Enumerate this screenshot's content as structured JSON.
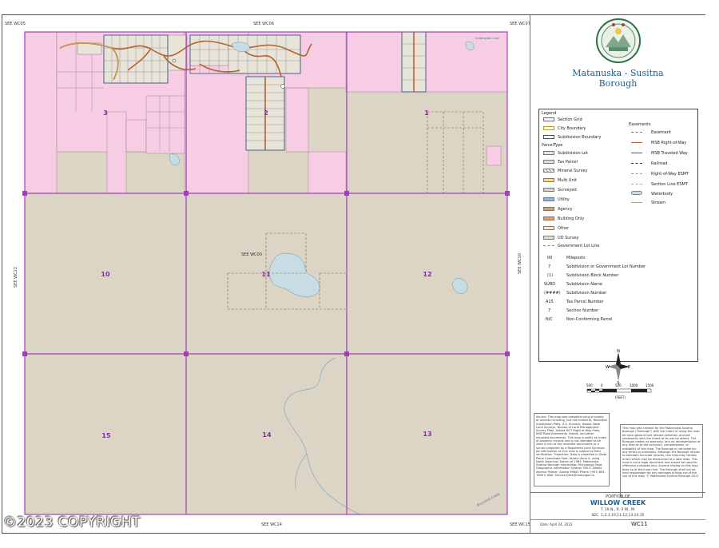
{
  "borough": {
    "name_line1": "Matanuska - Susitna",
    "name_line2": "Borough"
  },
  "see_refs": {
    "top_left": "SEE WC05",
    "top_mid": "SEE WC06",
    "top_right": "SEE WC07",
    "left": "SEE WC12",
    "right": "SEE WC10",
    "bottom_mid": "SEE WC14",
    "bottom_right": "SEE WC15",
    "center": "SEE WC00"
  },
  "sections": {
    "s3": "3",
    "s2": "2",
    "s1": "1",
    "s10": "10",
    "s11": "11",
    "s12": "12",
    "s15": "15",
    "s14": "14",
    "s13": "13"
  },
  "map_labels": {
    "stream": "Bruceline Creek",
    "lake": "Underwater Lake"
  },
  "legend": {
    "title": "Legend",
    "section_grid": "Section Grid",
    "city_boundary": "City Boundary",
    "subdivision_boundary": "Subdivision Boundary",
    "parcel_type": "ParcelType",
    "subdivision_lot": "Subdivision Lot",
    "tax_parcel": "Tax Parcel",
    "mineral_survey": "Mineral Survey",
    "multi_unit": "Multi Unit",
    "surveyed": "Surveyed",
    "utility": "Utility",
    "agency": "Agency",
    "building_only": "Building Only",
    "other": "Other",
    "ud_survey": "UD Survey",
    "gov_lot_line": "Government Lot Line",
    "easements": "Easements",
    "easement": "Easement",
    "msb_row": "MSB Right-of-Way",
    "msb_traveled": "MSB Traveled Way",
    "railroad": "Railroad",
    "row_esmt": "Right-of-Way ESMT",
    "section_line_esmt": "Section Line ESMT",
    "waterbody": "Waterbody",
    "stream": "Stream",
    "mileposts_sym": "00",
    "mileposts": "Mileposts",
    "lot_num_sym": "7",
    "lot_num": "Subdivision or Government Lot Number",
    "block_sym": "(1)",
    "block": "Subdivision Block Number",
    "subname_sym": "SUBD",
    "subname": "Subdivision Name",
    "subnum_sym": "(####)",
    "subnum": "Subdivision Number",
    "taxnum_sym": "A15",
    "taxnum": "Tax Parcel Number",
    "secnum_sym": "7",
    "secnum": "Section Number",
    "nonconf_sym": "N/C",
    "nonconf": "Non-Conforming Parcel"
  },
  "scale": {
    "ticks": [
      "500",
      "0",
      "500",
      "1000",
      "1500"
    ],
    "unit": "(FEET)"
  },
  "compass": {
    "n": "N",
    "s": "S",
    "e": "E",
    "w": "W"
  },
  "disclaimer_left": "Source: This map was compiled using a variety of sources including, but not limited to, Recorded Subdivision Plats, U.S. Surveys, Alaska State Land Surveys, Bureau of Land Management Survey Plats, Alaska DOT Right of Way Plats, MSB Road Easements, Deeds, and other recorded documents. This map is solely an index of property records and is not intended to be used in lieu of the recorded documents or a survey prepared by a Registered Land Surveyor. All information on this map is subject to field verification. Projection: Data is projected in State Plane Coordinate Feet, Alaska Zone 4, using North American Datum of 1983. Matanuska-Susitna Borough Information Technology Dept. Geographic Information System 350 E. Dahlia Avenue Palmer, Alaska 99645 Phone: (907) 861-7800 E-Mail: Service.Desk@matsugov.us",
  "disclaimer_right": "This map was created for the Matanuska-Susitna Borough (\"Borough\") with the intent of using the map for local government related activities, and not necessarily with the intent of its use by others. The Borough makes no warranty, and no representation of any kind as to the accuracy, completeness, or suitability of this map. The Borough is not liable for any errors or omissions. Although the Borough strives to maintain accurate records, this map may contain errors which may be discovered at a later date. This map is not a legal document and should be used for reference purposes only. Anyone relying on this map does so at their own risk. The Borough shall not be held responsible for any damages arising out of the use of this map. © Matanuska-Susitna Borough 2017",
  "title_block": {
    "portion_of": "PORTION OF",
    "name": "WILLOW CREEK",
    "township": "T. 19 N., R. 3 W., M.",
    "sections": "SEC. 1,2,3,10,11,12,13,14,15",
    "date": "Date: April 24, 2023",
    "sheet": "WC11"
  },
  "copyright": "©2023 COPYRIGHT"
}
